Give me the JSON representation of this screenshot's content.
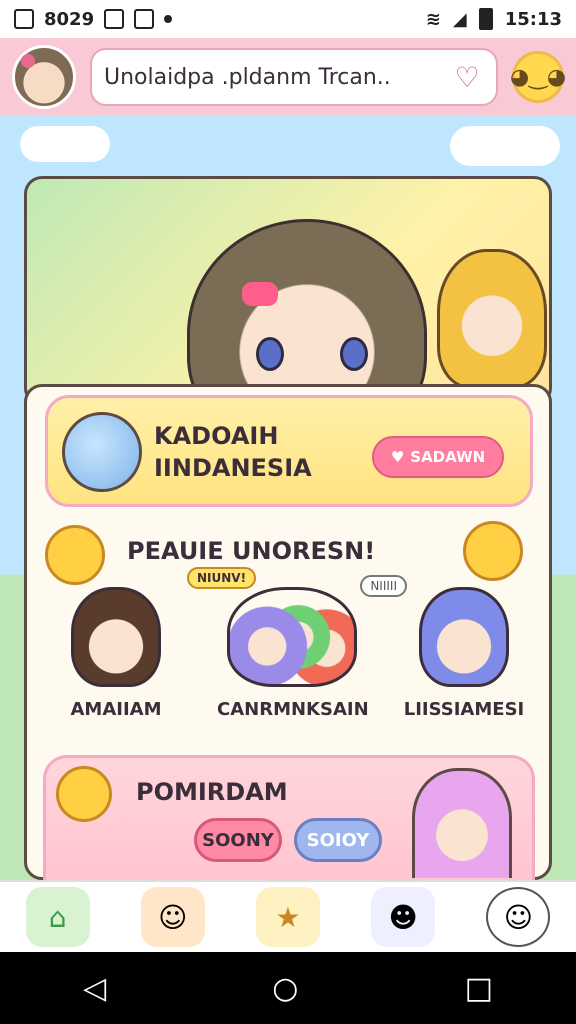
{
  "status_bar": {
    "left_text": "8029",
    "time": "15:13"
  },
  "header": {
    "search_text": "Unolaidpa .pldanm Trcan..",
    "avatar_icon": "profile-avatar",
    "heart_icon": "heart-icon"
  },
  "region_card": {
    "line1": "KADOAIH",
    "line2": "IINDANESIA",
    "button_label": "SADAWN"
  },
  "section": {
    "title": "PEAUIE UNORESN!"
  },
  "characters": [
    {
      "label": "AMAIIAM"
    },
    {
      "label": "CANRMNKSAIN"
    },
    {
      "label": "LIISSIAMESI"
    }
  ],
  "speech": {
    "left": "NIUNV!",
    "right": "NIIIII"
  },
  "favorites": {
    "title": "POMIRDAM",
    "chip1": "SOONY",
    "chip2": "SOIOY"
  },
  "colors": {
    "header_bg": "#f9c9d6",
    "accent_pink": "#ff7ea0",
    "accent_blue": "#9fb7ee"
  }
}
